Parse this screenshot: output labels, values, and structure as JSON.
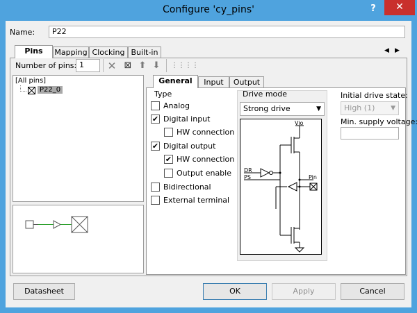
{
  "window": {
    "title": "Configure 'cy_pins'",
    "help": "?",
    "close": "✕"
  },
  "name": {
    "label": "Name:",
    "value": "P22"
  },
  "tabs": [
    {
      "label": "Pins"
    },
    {
      "label": "Mapping"
    },
    {
      "label": "Clocking"
    },
    {
      "label": "Built-in"
    }
  ],
  "tab_scroll": {
    "left": "◀",
    "right": "▶"
  },
  "toolbar": {
    "num_pins_label": "Number of pins:",
    "num_pins_value": "1",
    "delete": "✕",
    "add": "⊠",
    "up": "⬆",
    "down": "⬇",
    "a": "⋮⋮",
    "b": "⋮⋮"
  },
  "tree": {
    "root": "[All pins]",
    "child": "P22_0"
  },
  "subtabs": [
    {
      "label": "General"
    },
    {
      "label": "Input"
    },
    {
      "label": "Output"
    }
  ],
  "type": {
    "title": "Type",
    "options": [
      {
        "label": "Analog",
        "checked": ""
      },
      {
        "label": "Digital input",
        "checked": "✔"
      },
      {
        "label": "HW connection",
        "checked": ""
      },
      {
        "label": "Digital output",
        "checked": "✔"
      },
      {
        "label": "HW connection",
        "checked": "✔"
      },
      {
        "label": "Output enable",
        "checked": ""
      },
      {
        "label": "Bidirectional",
        "checked": ""
      },
      {
        "label": "External terminal",
        "checked": ""
      }
    ]
  },
  "drive": {
    "title": "Drive mode",
    "value": "Strong drive",
    "diagram": {
      "vio": "Vio",
      "dr": "DR",
      "ps": "PS",
      "pin": "Pin"
    }
  },
  "initial_drive": {
    "label": "Initial drive state:",
    "value": "High (1)"
  },
  "min_supply": {
    "label": "Min. supply voltage:",
    "value": ""
  },
  "buttons": {
    "datasheet": "Datasheet",
    "ok": "OK",
    "apply": "Apply",
    "cancel": "Cancel"
  }
}
